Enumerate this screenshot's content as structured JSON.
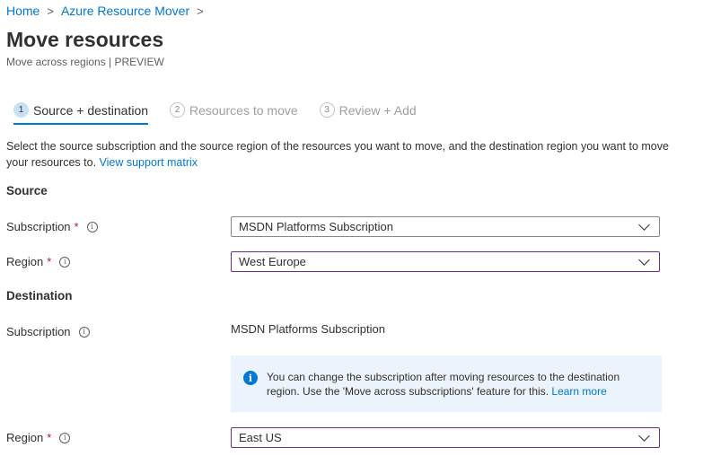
{
  "breadcrumb": {
    "items": [
      "Home",
      "Azure Resource Mover"
    ],
    "separator": ">"
  },
  "header": {
    "title": "Move resources",
    "subtitle": "Move across regions | PREVIEW"
  },
  "steps": [
    {
      "number": "1",
      "label": "Source + destination"
    },
    {
      "number": "2",
      "label": "Resources to move"
    },
    {
      "number": "3",
      "label": "Review + Add"
    }
  ],
  "intro": {
    "text": "Select the source subscription and the source region of the resources you want to move, and the destination region you want to move your resources to. ",
    "link": "View support matrix"
  },
  "source": {
    "heading": "Source",
    "subscription_label": "Subscription",
    "subscription_value": "MSDN Platforms Subscription",
    "region_label": "Region",
    "region_value": "West Europe"
  },
  "destination": {
    "heading": "Destination",
    "subscription_label": "Subscription",
    "subscription_value": "MSDN Platforms Subscription",
    "info_text": "You can change the subscription after moving resources to the destination region. Use the 'Move across subscriptions' feature for this. ",
    "info_link": "Learn more",
    "region_label": "Region",
    "region_value": "East US"
  },
  "glyphs": {
    "required": "*",
    "info_small": "i",
    "info_large": "i"
  },
  "colors": {
    "accent": "#0078d4",
    "focus_border": "#6b2d8f",
    "required": "#a4262c",
    "info_bg": "#ebf3fc"
  }
}
